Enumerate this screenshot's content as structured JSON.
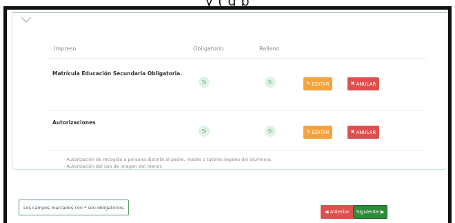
{
  "top_fragment": "y (       g   p",
  "table": {
    "headers": {
      "impreso": "Impreso",
      "obligatorio": "Obligatorio",
      "relleno": "Relleno"
    },
    "rows": [
      {
        "title": "Matrícula Educación Secundaria Obligatoria.",
        "obligatorio": "Sí",
        "relleno": "Sí",
        "edit_label": "EDITAR",
        "cancel_label": "ANULAR"
      },
      {
        "title": "Autorizaciones",
        "obligatorio": "Sí",
        "relleno": "Sí",
        "edit_label": "EDITAR",
        "cancel_label": "ANULAR"
      }
    ],
    "notes": [
      "- Autorización de recogida a persona distinta al padre, madre o tutores legales del alumno/a.",
      "- Autorización del uso de imagen del menor."
    ]
  },
  "footer": {
    "required_notice": "Los campos marcados con * son obligatorios.",
    "prev_label": "Anterior",
    "next_label": "Siguiente"
  },
  "colors": {
    "edit": "#f5a33c",
    "cancel": "#e04f4f",
    "next": "#2f8b3c",
    "badge_bg": "#dff3e4"
  },
  "icons": {
    "edit": "pencil-icon",
    "cancel": "x-icon",
    "prev": "arrow-left-icon",
    "next": "arrow-right-icon",
    "collapse": "chevron-down-icon"
  }
}
